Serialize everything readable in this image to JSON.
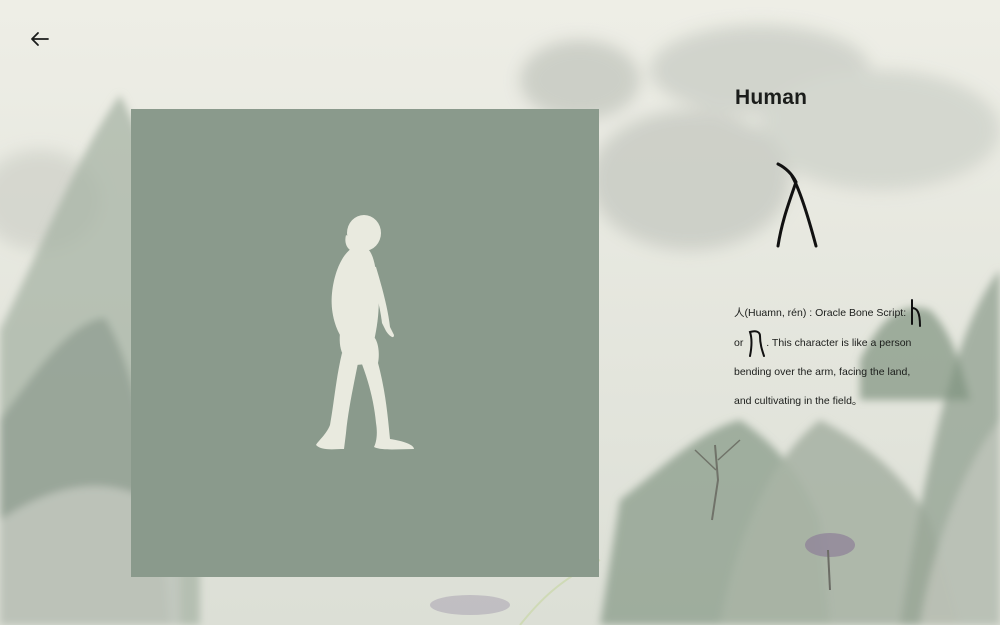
{
  "nav": {
    "back_icon": "arrow-left-icon"
  },
  "character": {
    "title": "Human",
    "glyph_icon": "oracle-bone-ren-glyph",
    "description": {
      "part1": "人(Huamn, rén) : Oracle Bone Script:",
      "or_word": "or",
      "part2": ". This character is like a person",
      "line3": "bending over the arm, facing the land,",
      "line4": "and cultivating in the field。"
    }
  },
  "illustration": {
    "subject_icon": "walking-early-human-silhouette"
  },
  "colors": {
    "panel": "#8a9a8c",
    "silhouette": "#e9eadf",
    "text": "#1b1d1b",
    "background": "#e6e7df"
  }
}
